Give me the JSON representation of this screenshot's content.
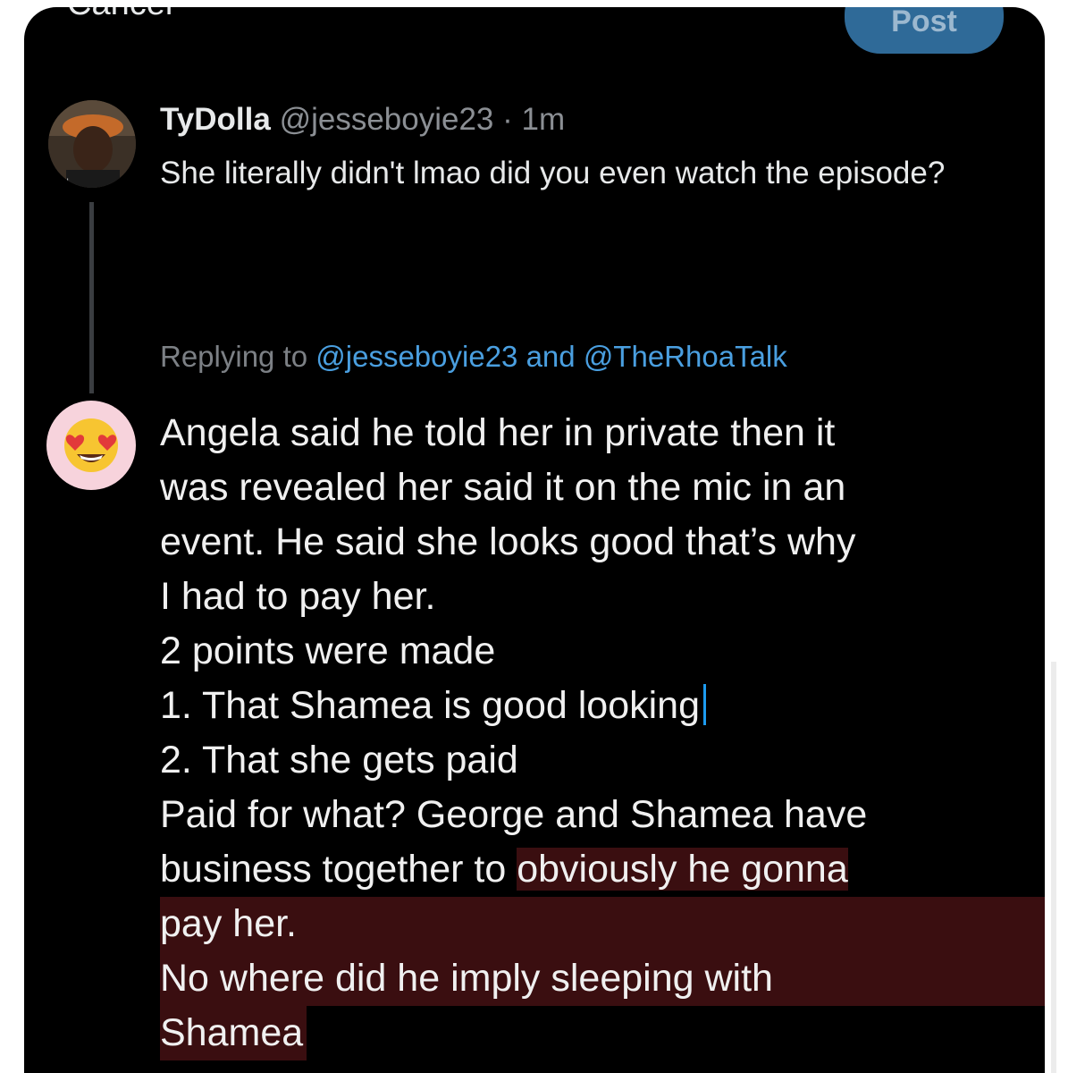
{
  "composer": {
    "cancel_label": "Cancel",
    "post_label": "Post"
  },
  "original_tweet": {
    "display_name": "TyDolla",
    "handle": "@jesseboyie23",
    "separator": " · ",
    "time": "1m",
    "text": "She literally didn't lmao did you even watch the episode?"
  },
  "replying_to": {
    "prefix": "Replying to ",
    "mention_1": "@jesseboyie23",
    "conjunction": " and ",
    "mention_2": "@TheRhoaTalk"
  },
  "reply": {
    "avatar_icon": "heart-eyes-emoji-icon",
    "lines": [
      "Angela said he told her in private then it",
      "was revealed her said it on the mic in an",
      "event.  He said she looks good that’s why",
      "I had to pay her.",
      "2 points were made",
      "1. That Shamea is good looking",
      "2. That she gets paid",
      "Paid for what? George and Shamea have",
      "business together to ",
      "obviously he gonna",
      "pay her.",
      "No where did he imply sleeping with",
      "Shamea"
    ]
  },
  "colors": {
    "background": "#000000",
    "text": "#e7e9ea",
    "muted": "#8b8f94",
    "mention": "#4a9fe0",
    "post_button": "#2f6a98",
    "highlight": "#3a0e10",
    "caret": "#1d9bf0"
  }
}
